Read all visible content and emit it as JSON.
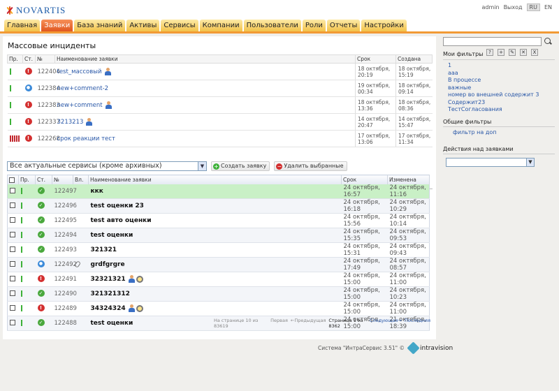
{
  "brand": {
    "logo_text": "NOVARTIS"
  },
  "header": {
    "user": "admin",
    "logout": "Выход",
    "lang_ru": "RU",
    "lang_en": "EN"
  },
  "nav": {
    "tabs": [
      "Главная",
      "Заявки",
      "База знаний",
      "Активы",
      "Сервисы",
      "Компании",
      "Пользователи",
      "Роли",
      "Отчеты",
      "Настройки"
    ],
    "active": "Заявки"
  },
  "mass": {
    "title": "Массовые инциденты",
    "columns": [
      "Пр.",
      "Ст.",
      "№",
      "Наименование заявки",
      "Срок",
      "Создана"
    ],
    "rows": [
      {
        "priority_bars": 1,
        "status": "red",
        "num": "122404",
        "name": "test_массовый",
        "user_icon": true,
        "due": [
          "18 октября,",
          "20:19"
        ],
        "created": [
          "18 октября,",
          "15:19"
        ]
      },
      {
        "priority_bars": 1,
        "status": "blue",
        "num": "122384",
        "name": "new+comment-2",
        "user_icon": false,
        "due": [
          "19 октября,",
          "00:34"
        ],
        "created": [
          "18 октября,",
          "09:14"
        ]
      },
      {
        "priority_bars": 1,
        "status": "red",
        "num": "122383",
        "name": "new+comment",
        "user_icon": true,
        "due": [
          "18 октября,",
          "13:36"
        ],
        "created": [
          "18 октября,",
          "08:36"
        ]
      },
      {
        "priority_bars": 1,
        "status": "red",
        "num": "122337",
        "name": "3213213",
        "user_icon": true,
        "due": [
          "14 октября,",
          "20:47"
        ],
        "created": [
          "14 октября,",
          "15:47"
        ]
      },
      {
        "priority_bars": 5,
        "status": "red",
        "num": "122268",
        "name": "срок реакции тест",
        "user_icon": false,
        "due": [
          "17 октября,",
          "13:06"
        ],
        "created": [
          "17 октября,",
          "11:34"
        ]
      }
    ]
  },
  "toolbar": {
    "service_select": "Все актуальные сервисы (кроме архивных)",
    "create_label": "Создать заявку",
    "delete_label": "Удалить выбранные"
  },
  "list": {
    "columns": [
      "Пр.",
      "Ст.",
      "№",
      "Вл.",
      "Наименование заявки",
      "Срок",
      "Изменена"
    ],
    "rows": [
      {
        "num": "122497",
        "status": "green",
        "attach": false,
        "name": "ккк",
        "icons": [],
        "due": "24 октября, 16:57",
        "changed": "24 октября, 11:16",
        "highlight": true
      },
      {
        "num": "122496",
        "status": "green",
        "attach": false,
        "name": "test оценки 23",
        "icons": [],
        "due": "24 октября, 16:18",
        "changed": "24 октября, 10:29"
      },
      {
        "num": "122495",
        "status": "green",
        "attach": false,
        "name": "test авто оценки",
        "icons": [],
        "due": "24 октября, 15:56",
        "changed": "24 октября, 10:14"
      },
      {
        "num": "122494",
        "status": "green",
        "attach": false,
        "name": "test оценки",
        "icons": [],
        "due": "24 октября, 15:35",
        "changed": "24 октября, 09:53"
      },
      {
        "num": "122493",
        "status": "green",
        "attach": false,
        "name": "321321",
        "icons": [],
        "due": "24 октября, 15:31",
        "changed": "24 октября, 09:43"
      },
      {
        "num": "122492",
        "status": "blue",
        "attach": true,
        "name": "grdfgrgre",
        "icons": [],
        "due": "24 октября, 17:49",
        "changed": "24 октября, 08:57"
      },
      {
        "num": "122491",
        "status": "red",
        "attach": false,
        "name": "32321321",
        "icons": [
          "user",
          "mag"
        ],
        "due": "24 октября, 15:00",
        "changed": "24 октября, 11:00"
      },
      {
        "num": "122490",
        "status": "green",
        "attach": false,
        "name": "321321312",
        "icons": [],
        "due": "24 октября, 15:00",
        "changed": "24 октября, 10:23"
      },
      {
        "num": "122489",
        "status": "red",
        "attach": false,
        "name": "34324324",
        "icons": [
          "user",
          "mag"
        ],
        "due": "24 октября, 15:00",
        "changed": "24 октября, 11:00"
      },
      {
        "num": "122488",
        "status": "green",
        "attach": false,
        "name": "test оценки",
        "icons": [],
        "due": "24 октября, 15:00",
        "changed": "21 октября, 18:39"
      }
    ]
  },
  "pager": {
    "per_page": "На странице 10 из 83619",
    "first": "Первая",
    "prev": "←Предыдущая",
    "current": "Страница 1 из 8362",
    "next": "Следующая→",
    "last": "Последняя"
  },
  "footer": {
    "system": "Система \"ИнтраСервис 3.51\" ©",
    "vendor": "intravision"
  },
  "sidebar": {
    "search_placeholder": "",
    "my_filters_title": "Мои фильтры",
    "my_filters": [
      "1",
      "ааа",
      "В процессе",
      "важные",
      "номер во внешней содержит 3",
      "Содержит23",
      "ТестСогласования"
    ],
    "common_filters_title": "Общие фильтры",
    "common_filters": [
      "фильтр на доп"
    ],
    "actions_title": "Действия над заявками",
    "actions_select": ""
  },
  "colors": {
    "nav_active": "#e8652a",
    "nav_tab": "#f5cc5a",
    "nav_line": "#f29a35",
    "highlight_row": "#c9f0c6"
  }
}
